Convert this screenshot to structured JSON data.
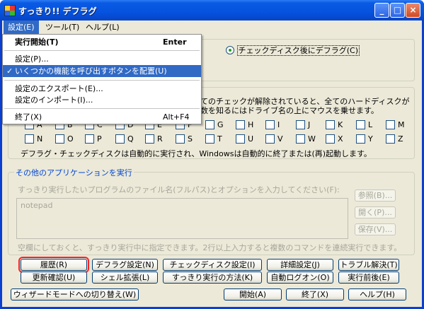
{
  "window": {
    "title": "すっきり!! デフラグ",
    "minimize": "_",
    "maximize": "□",
    "close": "×"
  },
  "menubar": [
    "設定(E)",
    "ツール(T)",
    "ヘルプ(L)"
  ],
  "dropdown": {
    "items": [
      {
        "label": "実行開始(T)",
        "shortcut": "Enter"
      },
      {
        "label": "設定(P)...",
        "shortcut": ""
      },
      {
        "label": "いくつかの機能を呼び出すボタンを配置(U)",
        "shortcut": "",
        "checked": true
      },
      {
        "label": "設定のエクスポート(E)...",
        "shortcut": ""
      },
      {
        "label": "設定のインポート(I)...",
        "shortcut": ""
      },
      {
        "label": "終了(X)",
        "shortcut": "Alt+F4"
      }
    ],
    "check_mark": "✓"
  },
  "option": {
    "label": "チェックディスク後にデフラグ(C)",
    "selected": true
  },
  "drive_text": {
    "line1": "てのチェックが解除されていると、全てのハードディスクが",
    "line2": "数を知るにはドライブ名の上にマウスを乗せます。"
  },
  "drives_row1": [
    "A",
    "B",
    "C",
    "D",
    "E",
    "F",
    "G",
    "H",
    "I",
    "J",
    "K",
    "L",
    "M"
  ],
  "drives_row2": [
    "N",
    "O",
    "P",
    "Q",
    "R",
    "S",
    "T",
    "U",
    "V",
    "W",
    "X",
    "Y",
    "Z"
  ],
  "auto_run_note": "デフラグ・チェックディスクは自動的に実行され、Windowsは自動的に終了または(再)起動します。",
  "apps": {
    "group_title": "その他のアプリケーションを実行",
    "instruction": "すっきり実行したいプログラムのファイル名(フルパス)とオプションを入力してください(F):",
    "textarea_value": "notepad",
    "browse": "参照(B)...",
    "open": "開く(P)...",
    "save": "保存(V)...",
    "hint": "空欄にしておくと、すっきり実行中に指定できます。2行以上入力すると複数のコマンドを連続実行できます。"
  },
  "buttons_row1": [
    "履歴(R)",
    "デフラグ設定(N)",
    "チェックディスク設定(I)",
    "詳細設定(J)",
    "トラブル解決(T)"
  ],
  "buttons_row2": [
    "更新確認(U)",
    "シェル拡張(L)",
    "すっきり実行の方法(K)",
    "自動ログオン(O)",
    "実行前後(E)"
  ],
  "bottom": {
    "wizard": "ウィザードモードへの切り替え(W)",
    "start": "開始(A)",
    "exit": "終了(X)",
    "help": "ヘルプ(H)"
  }
}
